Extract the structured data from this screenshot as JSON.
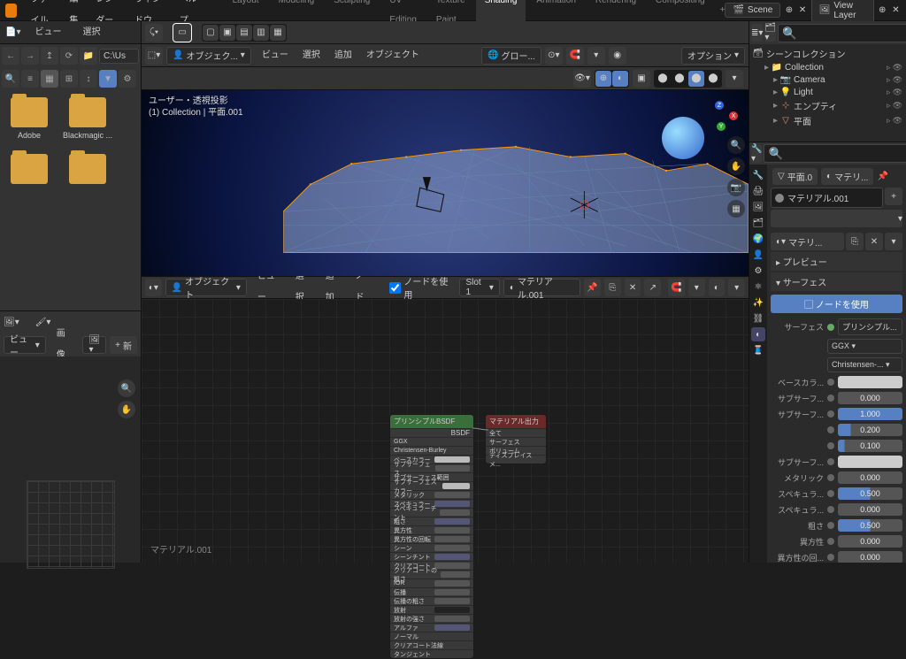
{
  "topmenu": [
    "ファイル",
    "編集",
    "レンダー",
    "ウィンドウ",
    "ヘルプ"
  ],
  "tabs": [
    "Layout",
    "Modeling",
    "Sculpting",
    "UV Editing",
    "Texture Paint",
    "Shading",
    "Animation",
    "Rendering",
    "Compositing"
  ],
  "active_tab": 5,
  "scene_name": "Scene",
  "view_layer": "View Layer",
  "file_browser": {
    "view_label": "ビュー",
    "select_label": "選択",
    "path": "C:\\Us",
    "folders": [
      "Adobe",
      "Blackmagic ..."
    ],
    "extra_folders": 2
  },
  "viewport": {
    "mode": "オブジェク...",
    "header_menu": [
      "ビュー",
      "選択",
      "追加",
      "オブジェクト"
    ],
    "overlay_title": "ユーザー・透視投影",
    "overlay_sub": "(1) Collection | 平面.001",
    "global": "グロー...",
    "options": "オプション"
  },
  "image_editor": {
    "view": "ビュー",
    "image": "画像",
    "new": "新"
  },
  "node_editor": {
    "mode": "オブジェクト",
    "menu": [
      "ビュー",
      "選択",
      "追加",
      "ノード"
    ],
    "use_nodes_label": "ノードを使用",
    "slot": "Slot 1",
    "material": "マテリアル.001",
    "footer_material": "マテリアル.001",
    "principled": {
      "title": "プリンシプルBSDF",
      "out": "BSDF",
      "rows": [
        {
          "l": "GGX"
        },
        {
          "l": "Christensen-Burley"
        },
        {
          "l": "ベースカラー",
          "sw": true
        },
        {
          "l": "サブサーフェス",
          "v": "0.000"
        },
        {
          "l": "サブサーフェス範囲"
        },
        {
          "l": "サブサーフェスカラー",
          "sw": true
        },
        {
          "l": "メタリック",
          "v": "0.000"
        },
        {
          "l": "スペキュラー",
          "v": "0.500",
          "blue": true
        },
        {
          "l": "スペキュラーチント",
          "v": "0.000"
        },
        {
          "l": "粗さ",
          "v": "0.500",
          "blue": true
        },
        {
          "l": "異方性",
          "v": "0.000"
        },
        {
          "l": "異方性の回転",
          "v": "0.000"
        },
        {
          "l": "シーン",
          "v": "0.000"
        },
        {
          "l": "シーンチント",
          "v": "0.500",
          "blue": true
        },
        {
          "l": "クリアコート",
          "v": "0.000"
        },
        {
          "l": "クリアコートの粗さ",
          "v": "0.030"
        },
        {
          "l": "IOR",
          "v": "1.450"
        },
        {
          "l": "伝播",
          "v": "0.000"
        },
        {
          "l": "伝播の粗さ",
          "v": "0.000"
        },
        {
          "l": "放射",
          "sw": true,
          "dark": true
        },
        {
          "l": "放射の強さ",
          "v": "1.000"
        },
        {
          "l": "アルファ",
          "v": "1.000",
          "blue": true
        },
        {
          "l": "ノーマル"
        },
        {
          "l": "クリアコート法線"
        },
        {
          "l": "タンジェント"
        }
      ]
    },
    "output": {
      "title": "マテリアル出力",
      "rows": [
        "全て",
        "サーフェス",
        "ボリューム",
        "ディスプレイスメ..."
      ]
    }
  },
  "outliner": {
    "root": "シーンコレクション",
    "items": [
      {
        "l": "Collection",
        "ic": "📁",
        "d": 1,
        "c": "#e8e8e8"
      },
      {
        "l": "Camera",
        "ic": "📷",
        "d": 2,
        "c": "#7aa"
      },
      {
        "l": "Light",
        "ic": "💡",
        "d": 2,
        "c": "#7aa"
      },
      {
        "l": "エンプティ",
        "ic": "⊹",
        "d": 2,
        "c": "#d97"
      },
      {
        "l": "平面",
        "ic": "▽",
        "d": 2,
        "c": "#d97"
      }
    ]
  },
  "properties": {
    "object": "平面.0",
    "mat_browse": "マテリ...",
    "material": "マテリアル.001",
    "active_mat": "マテリ...",
    "preview": "プレビュー",
    "surface": "サーフェス",
    "use_nodes": "ノードを使用",
    "surface_row": {
      "l": "サーフェス",
      "v": "プリンシプル..."
    },
    "dist": "GGX",
    "sss": "Christensen-...",
    "rows": [
      {
        "l": "ベースカラ...",
        "swatch": "#cccccc"
      },
      {
        "l": "サブサーフ...",
        "v": "0.000",
        "p": 0
      },
      {
        "l": "サブサーフ...",
        "v": "1.000",
        "p": 100
      },
      {
        "l": "",
        "v": "0.200",
        "p": 20
      },
      {
        "l": "",
        "v": "0.100",
        "p": 10
      },
      {
        "l": "サブサーフ...",
        "swatch": "#cccccc"
      },
      {
        "l": "メタリック",
        "v": "0.000",
        "p": 0
      },
      {
        "l": "スペキュラ...",
        "v": "0.500",
        "p": 50
      },
      {
        "l": "スペキュラ...",
        "v": "0.000",
        "p": 0
      },
      {
        "l": "粗さ",
        "v": "0.500",
        "p": 50
      },
      {
        "l": "異方性",
        "v": "0.000",
        "p": 0
      },
      {
        "l": "異方性の回...",
        "v": "0.000",
        "p": 0
      }
    ]
  }
}
